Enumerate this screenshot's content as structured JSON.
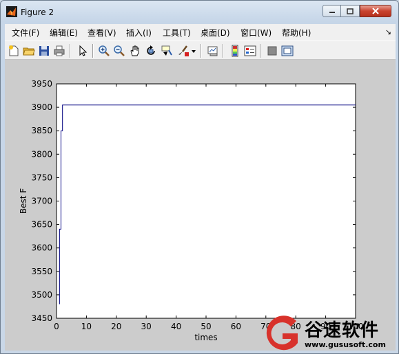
{
  "window": {
    "title": "Figure 2",
    "icon": "matlab-icon"
  },
  "menu": [
    "文件(F)",
    "编辑(E)",
    "查看(V)",
    "插入(I)",
    "工具(T)",
    "桌面(D)",
    "窗口(W)",
    "帮助(H)"
  ],
  "toolbar": {
    "icons": [
      "new-figure-icon",
      "open-file-icon",
      "save-icon",
      "print-icon",
      "select-arrow-icon",
      "zoom-in-icon",
      "zoom-out-icon",
      "pan-hand-icon",
      "rotate-3d-icon",
      "data-cursor-icon",
      "brush-icon",
      "brush-dropdown-icon",
      "link-plot-icon",
      "colorbar-icon",
      "legend-icon",
      "hide-plot-tools-icon",
      "show-plot-tools-icon"
    ]
  },
  "chart_data": {
    "type": "line",
    "xlabel": "times",
    "ylabel": "Best F",
    "xlim": [
      0,
      100
    ],
    "ylim": [
      3450,
      3950
    ],
    "xticks": [
      0,
      10,
      20,
      30,
      40,
      50,
      60,
      70,
      80,
      90,
      100
    ],
    "xtick_labels": [
      "0",
      "10",
      "20",
      "30",
      "40",
      "50",
      "60",
      "70",
      "80",
      "90",
      "100"
    ],
    "yticks": [
      3450,
      3500,
      3550,
      3600,
      3650,
      3700,
      3750,
      3800,
      3850,
      3900,
      3950
    ],
    "series": [
      {
        "color": "#000080",
        "x": [
          1,
          1,
          1.5,
          1.5,
          2,
          2,
          100
        ],
        "y": [
          3480,
          3640,
          3640,
          3850,
          3850,
          3905,
          3905
        ]
      }
    ],
    "grid": false
  },
  "watermark": {
    "text_cn": "谷速软件",
    "url": "www.gususoft.com",
    "color": "#d8322b"
  }
}
